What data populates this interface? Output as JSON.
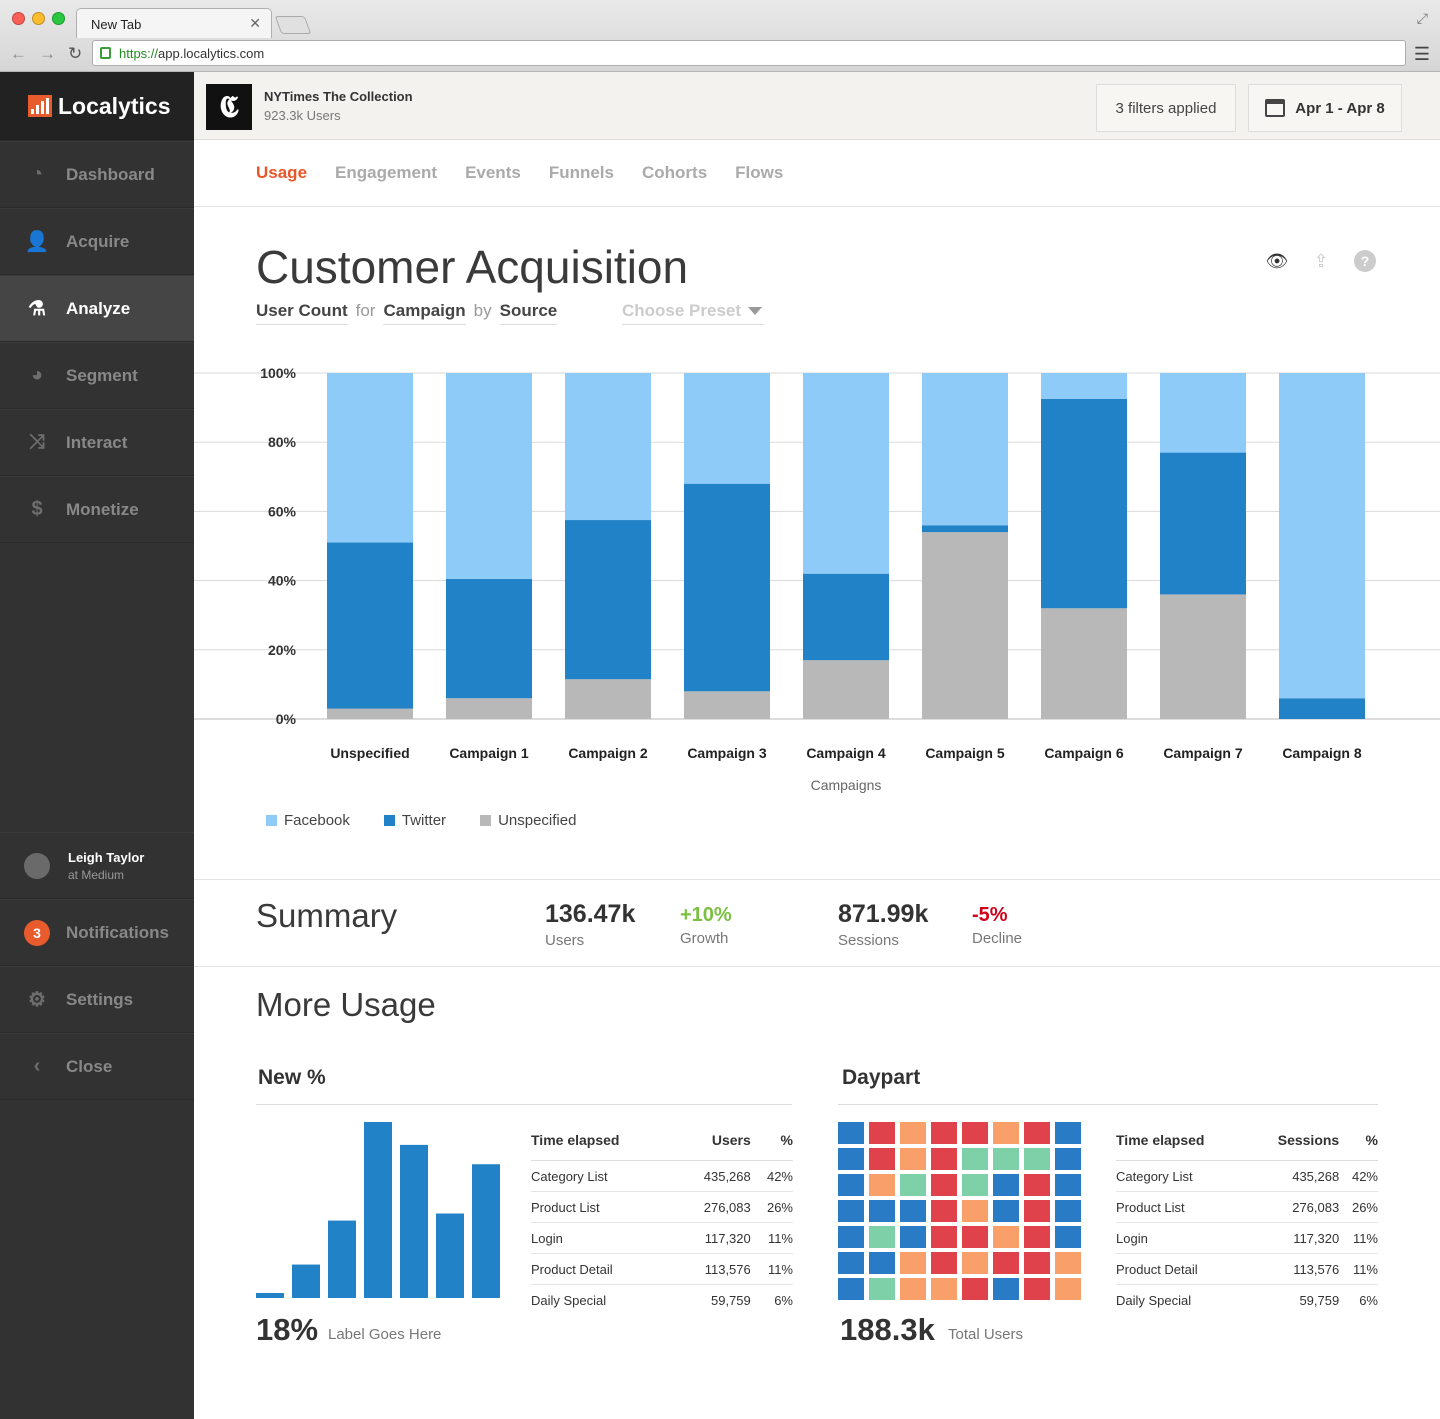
{
  "browser": {
    "tab_title": "New Tab",
    "url_scheme": "https://",
    "url_host": "app.localytics.com"
  },
  "brand": {
    "name": "Localytics",
    "accent": "#e85b2c"
  },
  "sidebar": {
    "items": [
      {
        "label": "Dashboard",
        "icon": "dashboard-icon"
      },
      {
        "label": "Acquire",
        "icon": "user-icon"
      },
      {
        "label": "Analyze",
        "icon": "flask-icon",
        "active": true
      },
      {
        "label": "Segment",
        "icon": "pie-icon"
      },
      {
        "label": "Interact",
        "icon": "shuffle-icon"
      },
      {
        "label": "Monetize",
        "icon": "dollar-icon"
      }
    ],
    "user": {
      "name": "Leigh Taylor",
      "org": "at Medium"
    },
    "notifications": {
      "label": "Notifications",
      "count": "3"
    },
    "settings": "Settings",
    "close": "Close"
  },
  "app": {
    "name": "NYTimes The Collection",
    "users": "923.3k Users",
    "filters": "3 filters applied",
    "date_range": "Apr 1 - Apr 8"
  },
  "tabs": [
    "Usage",
    "Engagement",
    "Events",
    "Funnels",
    "Cohorts",
    "Flows"
  ],
  "page": {
    "title": "Customer Acquisition",
    "query": {
      "metric": "User Count",
      "for": "for",
      "dimension": "Campaign",
      "by": "by",
      "breakdown": "Source"
    },
    "preset_placeholder": "Choose Preset"
  },
  "chart_data": {
    "type": "bar",
    "stacked": true,
    "categories": [
      "Unspecified",
      "Campaign 1",
      "Campaign 2",
      "Campaign 3",
      "Campaign 4",
      "Campaign 5",
      "Campaign 6",
      "Campaign 7",
      "Campaign 8"
    ],
    "series": [
      {
        "name": "Unspecified",
        "color": "#b8b8b8",
        "values": [
          3,
          6,
          11.5,
          8,
          17,
          54,
          32,
          36,
          0
        ]
      },
      {
        "name": "Twitter",
        "color": "#2282c8",
        "values": [
          48,
          34.5,
          46,
          60,
          25,
          2,
          60.5,
          41,
          6
        ]
      },
      {
        "name": "Facebook",
        "color": "#8ecbf9",
        "values": [
          49,
          59.5,
          42.5,
          32,
          58,
          44,
          7.5,
          23,
          94
        ]
      }
    ],
    "yticks": [
      "0%",
      "20%",
      "40%",
      "60%",
      "80%",
      "100%"
    ],
    "ylim": [
      0,
      100
    ],
    "xlabel": "Campaigns",
    "legend": [
      "Facebook",
      "Twitter",
      "Unspecified"
    ],
    "grid": true
  },
  "summary": {
    "title": "Summary",
    "users": {
      "value": "136.47k",
      "label": "Users"
    },
    "growth": {
      "value": "+10%",
      "label": "Growth",
      "color": "#7ac143"
    },
    "sessions": {
      "value": "871.99k",
      "label": "Sessions"
    },
    "decline": {
      "value": "-5%",
      "label": "Decline",
      "color": "#d0021b"
    }
  },
  "more": {
    "title": "More Usage",
    "new": {
      "title": "New %",
      "bars": [
        2,
        19,
        44,
        100,
        87,
        48,
        76
      ],
      "big": "18%",
      "big_label": "Label Goes Here",
      "headers": [
        "Time elapsed",
        "Users",
        "%"
      ],
      "rows": [
        [
          "Category List",
          "435,268",
          "42%"
        ],
        [
          "Product List",
          "276,083",
          "26%"
        ],
        [
          "Login",
          "117,320",
          "11%"
        ],
        [
          "Product Detail",
          "113,576",
          "11%"
        ],
        [
          "Daily Special",
          "59,759",
          "6%"
        ]
      ]
    },
    "daypart": {
      "title": "Daypart",
      "big": "188.3k",
      "big_label": "Total Users",
      "palette": {
        "b": "#2a7bc6",
        "r": "#e0424c",
        "o": "#f9a06a",
        "g": "#7ed0a8"
      },
      "grid": [
        "brorrorb",
        "brorgggb",
        "bogrgbrb",
        "bbbrobrb",
        "bgbrrorb",
        "bbororro",
        "bgoorbro"
      ],
      "headers": [
        "Time elapsed",
        "Sessions",
        "%"
      ],
      "rows": [
        [
          "Category List",
          "435,268",
          "42%"
        ],
        [
          "Product List",
          "276,083",
          "26%"
        ],
        [
          "Login",
          "117,320",
          "11%"
        ],
        [
          "Product Detail",
          "113,576",
          "11%"
        ],
        [
          "Daily Special",
          "59,759",
          "6%"
        ]
      ]
    }
  }
}
